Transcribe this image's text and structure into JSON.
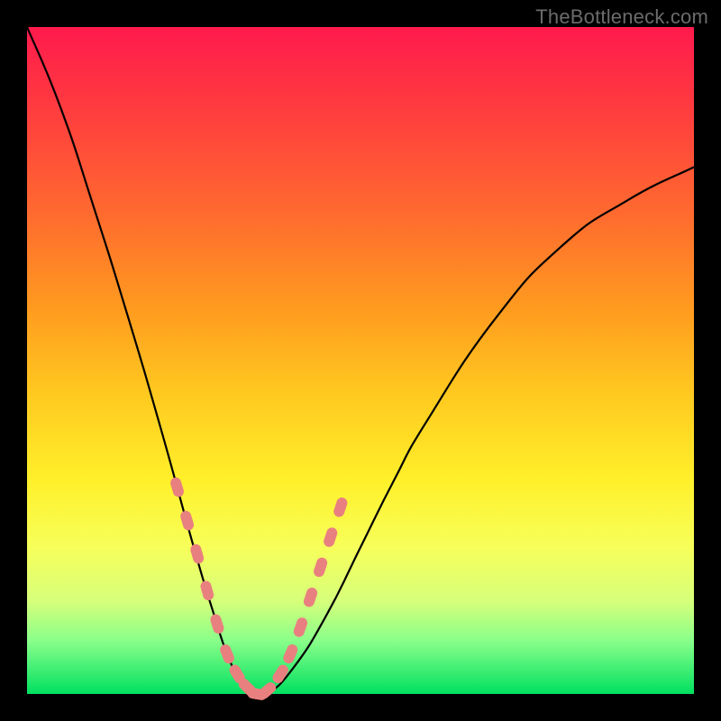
{
  "watermark": "TheBottleneck.com",
  "chart_data": {
    "type": "line",
    "title": "",
    "xlabel": "",
    "ylabel": "",
    "xlim": [
      0,
      100
    ],
    "ylim": [
      0,
      100
    ],
    "series": [
      {
        "name": "bottleneck-curve",
        "x": [
          0,
          5,
          10,
          15,
          20,
          25,
          28,
          30,
          32,
          34,
          36,
          40,
          45,
          50,
          55,
          60,
          70,
          80,
          90,
          100
        ],
        "y": [
          100,
          88,
          73,
          57,
          40,
          22,
          12,
          6,
          2,
          0,
          0,
          4,
          12,
          22,
          32,
          41,
          56,
          67,
          74,
          79
        ]
      }
    ],
    "markers": {
      "name": "highlighted-points",
      "color": "#e98080",
      "x": [
        22.5,
        24.0,
        25.5,
        27.0,
        28.5,
        30.0,
        31.5,
        33.0,
        34.5,
        36.0,
        38.0,
        39.5,
        41.0,
        42.5,
        44.0,
        45.5,
        47.0
      ],
      "y": [
        31.0,
        26.0,
        21.0,
        15.5,
        10.5,
        6.0,
        3.0,
        1.0,
        0.0,
        0.5,
        3.0,
        6.0,
        10.0,
        14.5,
        19.0,
        23.5,
        28.0
      ]
    }
  }
}
